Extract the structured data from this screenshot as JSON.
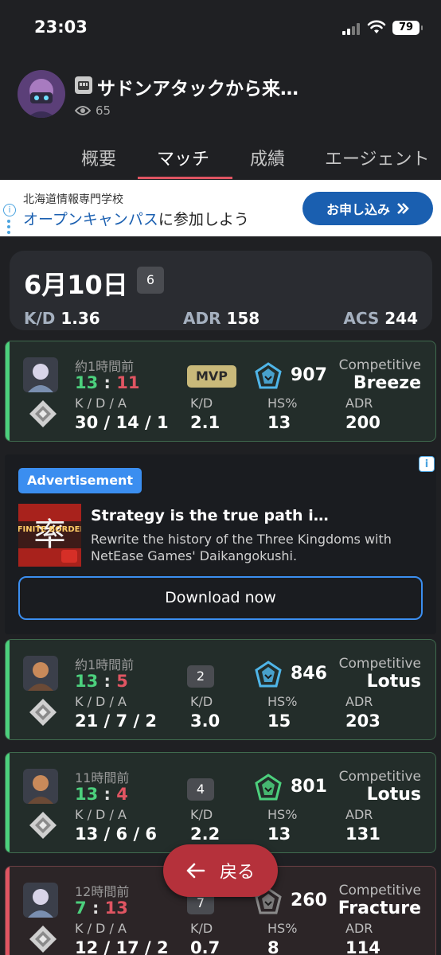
{
  "status_bar": {
    "time": "23:03",
    "battery": "79"
  },
  "profile": {
    "name": "サドンアタックから来…",
    "views": "65"
  },
  "tabs": [
    "概要",
    "マッチ",
    "成績",
    "エージェント"
  ],
  "top_ad": {
    "sub": "北海道情報専門学校",
    "title_highlight": "オープンキャンパス",
    "title_rest": "に参加しよう",
    "button": "お申し込み",
    "button_icon": "chevrons-right-icon"
  },
  "day_summary": {
    "date": "6月10日",
    "match_count": "6",
    "kd_label": "K/D",
    "kd": "1.36",
    "adr_label": "ADR",
    "adr": "158",
    "acs_label": "ACS",
    "acs": "244"
  },
  "stat_labels": {
    "kda": "K / D / A",
    "kd": "K/D",
    "hs": "HS%",
    "adr": "ADR"
  },
  "matches": [
    {
      "time": "約1時間前",
      "score_a": "13",
      "sep": ":",
      "score_b": "11",
      "result": "win",
      "badge": "MVP",
      "rr": "907",
      "mode": "Competitive",
      "map": "Breeze",
      "kda": "30 / 14 / 1",
      "kd": "2.1",
      "hs": "13",
      "adr": "200",
      "rank_color": "#4fb5e8"
    },
    {
      "time": "約1時間前",
      "score_a": "13",
      "sep": ":",
      "score_b": "5",
      "result": "win",
      "badge": "2",
      "rr": "846",
      "mode": "Competitive",
      "map": "Lotus",
      "kda": "21 / 7 / 2",
      "kd": "3.0",
      "hs": "15",
      "adr": "203",
      "rank_color": "#4fb5e8"
    },
    {
      "time": "11時間前",
      "score_a": "13",
      "sep": ":",
      "score_b": "4",
      "result": "win",
      "badge": "4",
      "rr": "801",
      "mode": "Competitive",
      "map": "Lotus",
      "kda": "13 / 6 / 6",
      "kd": "2.2",
      "hs": "13",
      "adr": "131",
      "rank_color": "#4cd07d"
    },
    {
      "time": "12時間前",
      "score_a": "7",
      "sep": ":",
      "score_b": "13",
      "result": "loss",
      "badge": "7",
      "rr": "260",
      "mode": "Competitive",
      "map": "Fracture",
      "kda": "12 / 17 / 2",
      "kd": "0.7",
      "hs": "8",
      "adr": "114",
      "rank_color": "#8a8a8a"
    }
  ],
  "ad": {
    "label": "Advertisement",
    "title": "Strategy is the true path i…",
    "description": "Rewrite the history of the Three Kingdoms with NetEase Games' Daikangokushi.",
    "button": "Download now",
    "thumb_text": "INFINITE BORDERS",
    "thumb_glyph": "率"
  },
  "back_button": {
    "label": "戻る",
    "icon": "arrow-left-icon"
  }
}
